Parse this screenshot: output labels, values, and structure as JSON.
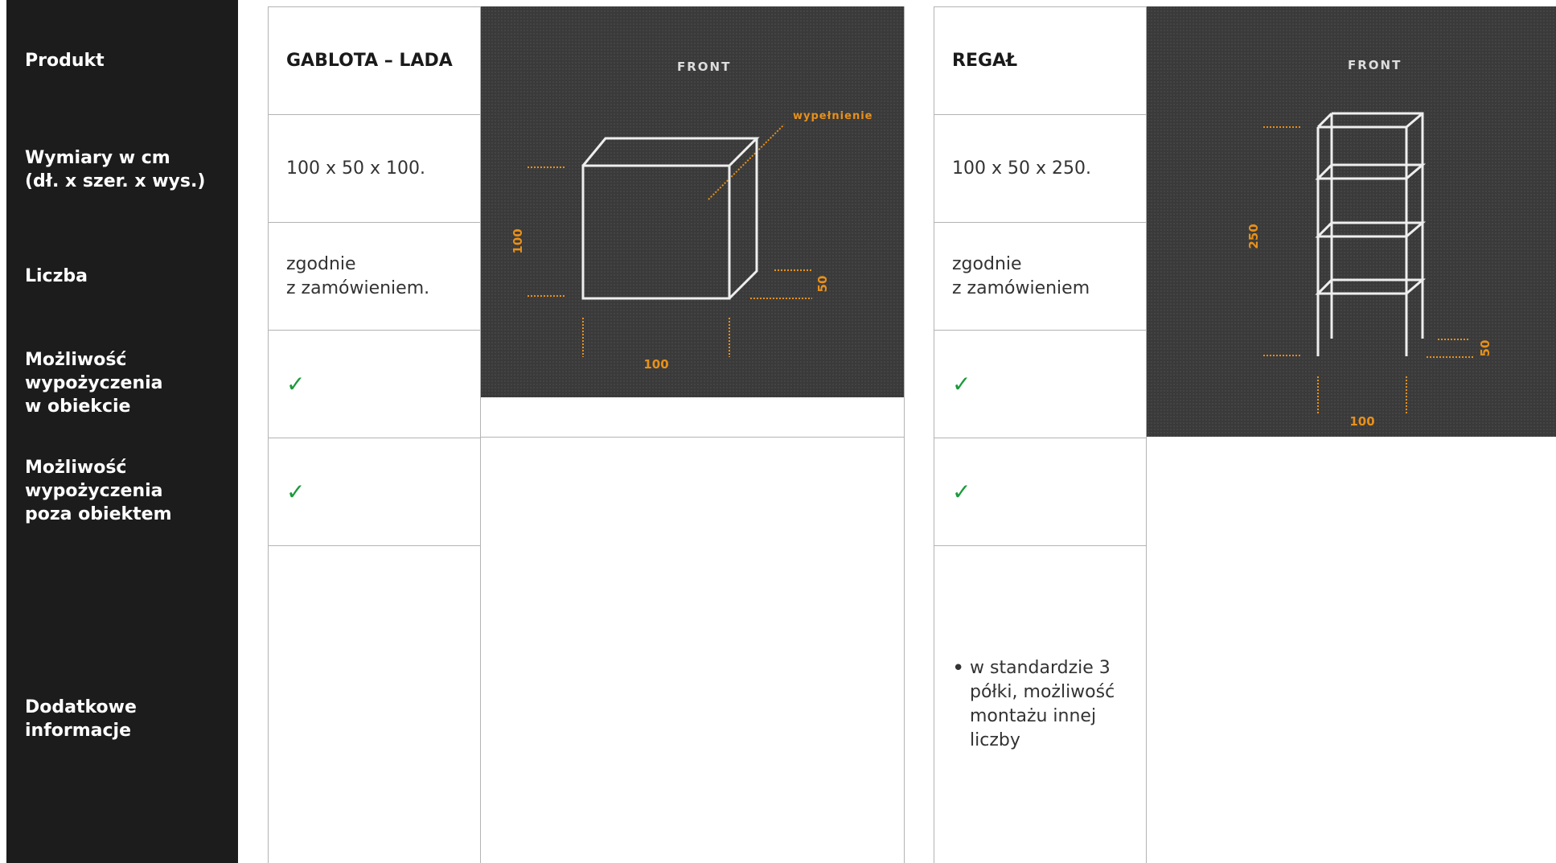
{
  "sidebar": {
    "labels": {
      "product": "Produkt",
      "dimensions_line1": "Wymiary w cm",
      "dimensions_line2": "(dł. x szer. x wys.)",
      "quantity": "Liczba",
      "rent_inside_1": "Możliwość",
      "rent_inside_2": "wypożyczenia",
      "rent_inside_3": "w obiekcie",
      "rent_outside_1": "Możliwość",
      "rent_outside_2": "wypożyczenia",
      "rent_outside_3": "poza obiektem",
      "additional": "Dodatkowe informacje"
    }
  },
  "products": [
    {
      "name": "GABLOTA – LADA",
      "dimensions": "100 x 50 x 100.",
      "quantity_line1": "zgodnie",
      "quantity_line2": "z zamówieniem.",
      "rent_inside": "✓",
      "rent_outside": "✓",
      "additional": [],
      "drawing": {
        "front_label": "FRONT",
        "fill_label": "wypełnienie",
        "height": "100",
        "depth": "50",
        "width": "100"
      }
    },
    {
      "name": "REGAŁ",
      "dimensions": "100 x 50 x 250.",
      "quantity_line1": "zgodnie",
      "quantity_line2": "z zamówieniem",
      "rent_inside": "✓",
      "rent_outside": "✓",
      "additional": [
        "w standardzie 3 półki, możliwość montażu innej liczby"
      ],
      "drawing": {
        "front_label": "FRONT",
        "height": "250",
        "depth": "50",
        "width": "100"
      }
    }
  ],
  "colors": {
    "sidebar_bg": "#1c1c1c",
    "accent_orange": "#e8901a",
    "check_green": "#1a9a3a",
    "drawing_bg": "#3a3a3a"
  }
}
